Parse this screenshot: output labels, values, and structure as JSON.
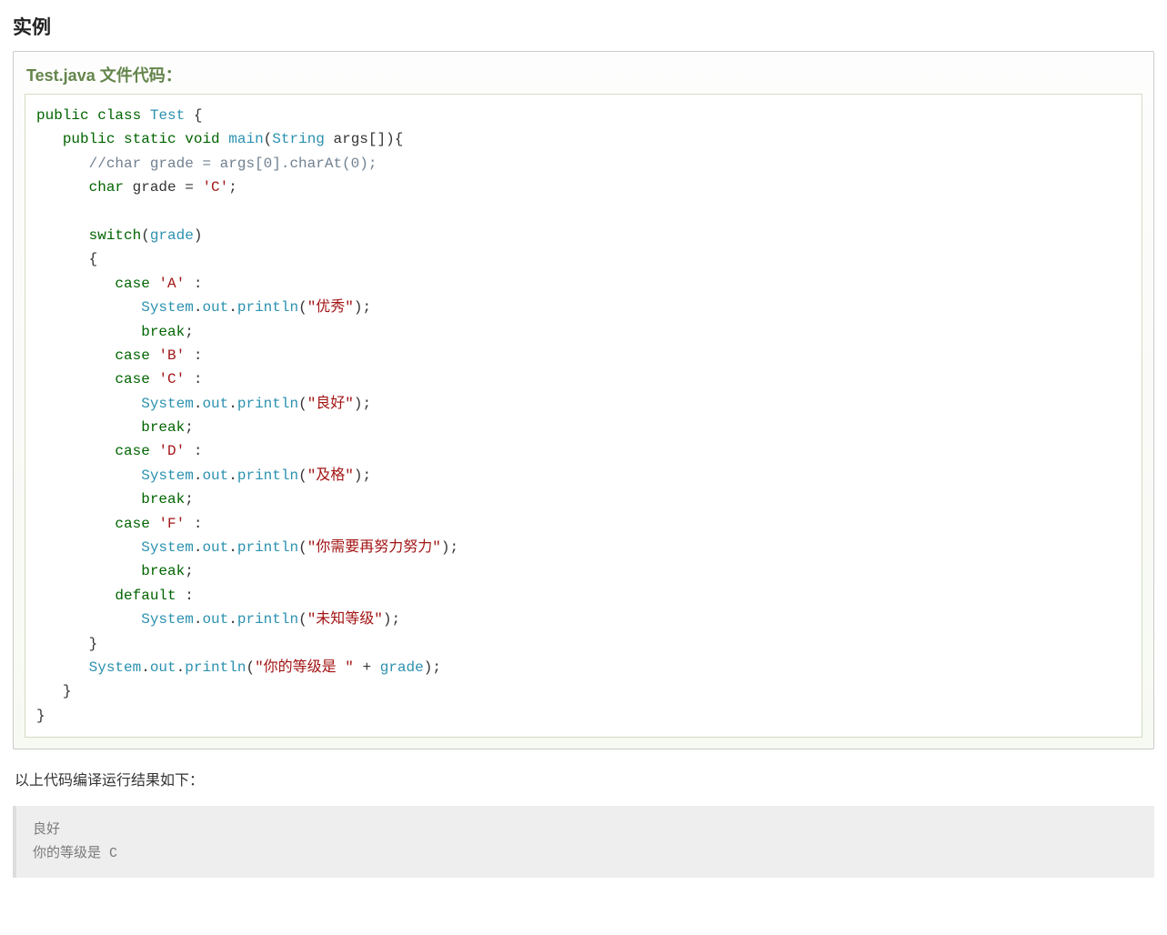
{
  "section": {
    "title": "实例"
  },
  "example": {
    "header": "Test.java 文件代码："
  },
  "code": {
    "kw_public1": "public",
    "kw_class": "class",
    "cls_Test": "Test",
    "brace_open1": " {",
    "kw_public2": "public",
    "kw_static": "static",
    "kw_void": "void",
    "m_main": "main",
    "paren_open1": "(",
    "t_String": "String",
    "args_decl": " args[]){",
    "comment1": "//char grade = args[0].charAt(0);",
    "kw_char": "char",
    "var_grade": " grade = ",
    "lit_C": "'C'",
    "semi1": ";",
    "kw_switch": "switch",
    "paren_open2": "(",
    "id_grade": "grade",
    "paren_close2": ")",
    "brace_open2": "{",
    "kw_case1": "case",
    "lit_A": "'A'",
    "colon1": " :",
    "sys1": "System",
    "dot1": ".",
    "out1": "out",
    "dot2": ".",
    "println1": "println",
    "po1": "(",
    "s1": "\"优秀\"",
    "pc1": ");",
    "kw_break1": "break",
    "semi_b1": ";",
    "kw_case2": "case",
    "lit_B": "'B'",
    "colon2": " :",
    "kw_case3": "case",
    "lit_C2": "'C'",
    "colon3": " :",
    "sys2": "System",
    "dot3": ".",
    "out2": "out",
    "dot4": ".",
    "println2": "println",
    "po2": "(",
    "s2": "\"良好\"",
    "pc2": ");",
    "kw_break2": "break",
    "semi_b2": ";",
    "kw_case4": "case",
    "lit_D": "'D'",
    "colon4": " :",
    "sys3": "System",
    "dot5": ".",
    "out3": "out",
    "dot6": ".",
    "println3": "println",
    "po3": "(",
    "s3": "\"及格\"",
    "pc3": ");",
    "kw_break3": "break",
    "semi_b3": ";",
    "kw_case5": "case",
    "lit_F": "'F'",
    "colon5": " :",
    "sys4": "System",
    "dot7": ".",
    "out4": "out",
    "dot8": ".",
    "println4": "println",
    "po4": "(",
    "s4": "\"你需要再努力努力\"",
    "pc4": ");",
    "kw_break4": "break",
    "semi_b4": ";",
    "kw_default": "default",
    "colon6": " :",
    "sys5": "System",
    "dot9": ".",
    "out5": "out",
    "dot10": ".",
    "println5": "println",
    "po5": "(",
    "s5": "\"未知等级\"",
    "pc5": ");",
    "brace_close2": "}",
    "sys6": "System",
    "dot11": ".",
    "out6": "out",
    "dot12": ".",
    "println6": "println",
    "po6": "(",
    "s6": "\"你的等级是 \"",
    "plus": " + ",
    "id_grade2": "grade",
    "pc6": ");",
    "brace_close3": "}",
    "brace_close4": "}"
  },
  "result": {
    "label": "以上代码编译运行结果如下：",
    "line1": "良好",
    "line2": "你的等级是 C"
  }
}
